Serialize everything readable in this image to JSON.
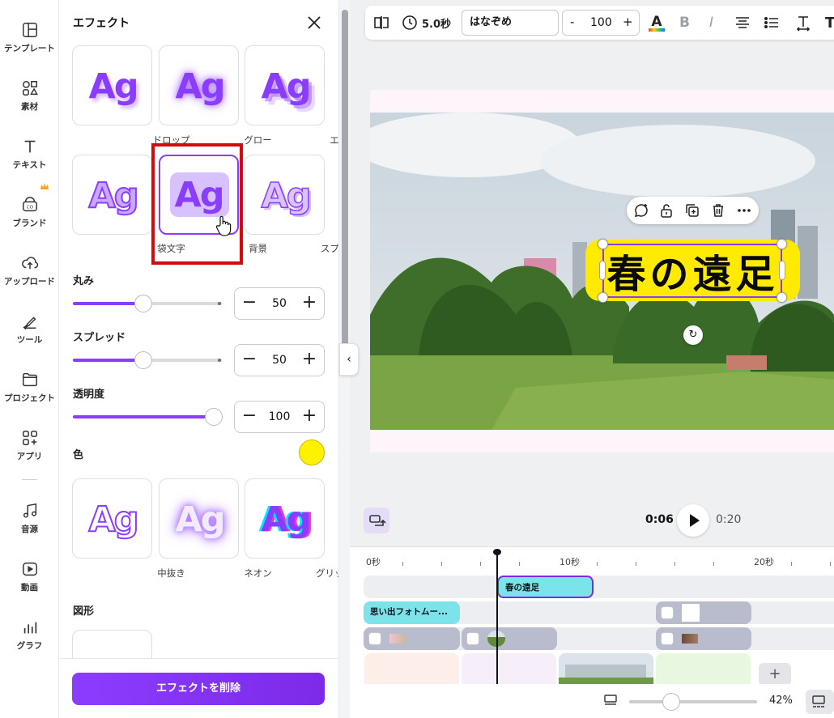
{
  "rail": {
    "items": [
      {
        "label": "テンプレート",
        "icon": "template-icon"
      },
      {
        "label": "素材",
        "icon": "elements-icon"
      },
      {
        "label": "テキスト",
        "icon": "text-icon"
      },
      {
        "label": "ブランド",
        "icon": "brand-icon"
      },
      {
        "label": "アップロード",
        "icon": "upload-icon"
      },
      {
        "label": "ツール",
        "icon": "tools-icon"
      },
      {
        "label": "プロジェクト",
        "icon": "folder-icon"
      },
      {
        "label": "アプリ",
        "icon": "apps-icon"
      },
      {
        "label": "音源",
        "icon": "music-icon"
      },
      {
        "label": "動画",
        "icon": "video-icon"
      },
      {
        "label": "グラフ",
        "icon": "chart-icon"
      }
    ]
  },
  "panel": {
    "title": "エフェクト",
    "effects": [
      {
        "label": "ドロップ"
      },
      {
        "label": "グロー"
      },
      {
        "label": "エコー"
      },
      {
        "label": "袋文字"
      },
      {
        "label": "背景",
        "selected": true
      },
      {
        "label": "スプライス"
      },
      {
        "label": "中抜き"
      },
      {
        "label": "ネオン"
      },
      {
        "label": "グリッチ加工"
      }
    ],
    "preview_text": "Ag",
    "roundness": {
      "label": "丸み",
      "value": "50",
      "fraction": 0.5
    },
    "spread": {
      "label": "スプレッド",
      "value": "50",
      "fraction": 0.5
    },
    "opacity": {
      "label": "透明度",
      "value": "100",
      "fraction": 1.0
    },
    "color": {
      "label": "色",
      "value": "#fff200"
    },
    "shapes_label": "図形",
    "delete_label": "エフェクトを削除",
    "minus": "−",
    "plus": "+"
  },
  "toolbar": {
    "duration": "5.0秒",
    "font": "はなぞめ",
    "size": "100",
    "minus": "-",
    "plus": "+",
    "accent": "#8b3dff"
  },
  "canvas": {
    "title_text": "春の遠足",
    "title_bg": "#ffea00"
  },
  "transport": {
    "current": "0:06",
    "total": "0:20"
  },
  "timeline": {
    "ruler": [
      "0秒",
      "10秒",
      "20秒"
    ],
    "clips": {
      "title": "春の遠足",
      "memories": "思い出フォトムー..."
    }
  },
  "zoom": {
    "value": "42%",
    "fraction": 0.33
  }
}
